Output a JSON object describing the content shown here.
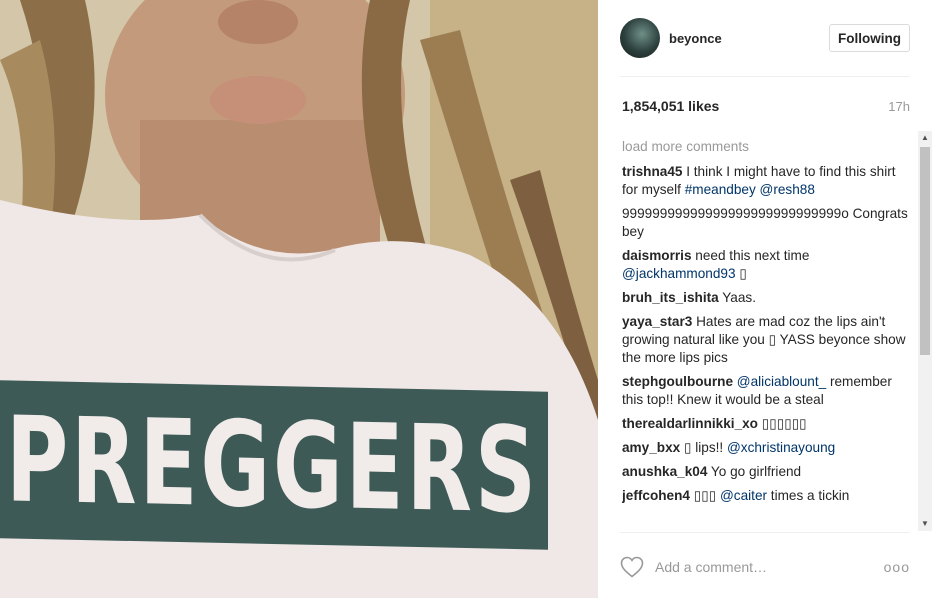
{
  "photo": {
    "shirt_text": "PREGGERS"
  },
  "post": {
    "username": "beyonce",
    "follow_label": "Following",
    "likes": "1,854,051 likes",
    "time": "17h",
    "load_more": "load more comments",
    "add_comment_placeholder": "Add a comment…",
    "more_label": "ooo"
  },
  "comments": [
    {
      "user": "trishna45",
      "parts": [
        {
          "t": " I think I might have to find this shirt for myself "
        },
        {
          "m": "#meandbey"
        },
        {
          "t": " "
        },
        {
          "m": "@resh88"
        }
      ]
    },
    {
      "user": "",
      "parts": [
        {
          "t": "99999999999999999999999999999o Congrats bey"
        }
      ]
    },
    {
      "user": "daismorris",
      "parts": [
        {
          "t": " need this next time "
        },
        {
          "m": "@jackhammond93"
        },
        {
          "t": " ▯"
        }
      ]
    },
    {
      "user": "bruh_its_ishita",
      "parts": [
        {
          "t": " Yaas."
        }
      ]
    },
    {
      "user": "yaya_star3",
      "parts": [
        {
          "t": " Hates are mad coz the lips ain't growing natural like you ▯ YASS beyonce show the more lips pics"
        }
      ]
    },
    {
      "user": "stephgoulbourne",
      "parts": [
        {
          "t": " "
        },
        {
          "m": "@aliciablount_"
        },
        {
          "t": " remember this top!! Knew it would be a steal"
        }
      ]
    },
    {
      "user": "therealdarlinnikki_xo",
      "parts": [
        {
          "t": " ▯▯▯▯▯▯"
        }
      ]
    },
    {
      "user": "amy_bxx",
      "parts": [
        {
          "t": " ▯ lips!! "
        },
        {
          "m": "@xchristinayoung"
        }
      ]
    },
    {
      "user": "anushka_k04",
      "parts": [
        {
          "t": " Yo go girlfriend"
        }
      ]
    },
    {
      "user": "jeffcohen4",
      "parts": [
        {
          "t": " ▯▯▯ "
        },
        {
          "m": "@caiter"
        },
        {
          "t": " times a tickin"
        }
      ]
    }
  ],
  "icons": {
    "heart": "heart-outline-icon",
    "more": "more-options-icon",
    "scroll_up": "scroll-up-arrow-icon",
    "scroll_down": "scroll-down-arrow-icon"
  },
  "colors": {
    "mention": "#003569",
    "muted": "#999999",
    "text": "#262626",
    "shirt_print": "#3d5a57"
  }
}
